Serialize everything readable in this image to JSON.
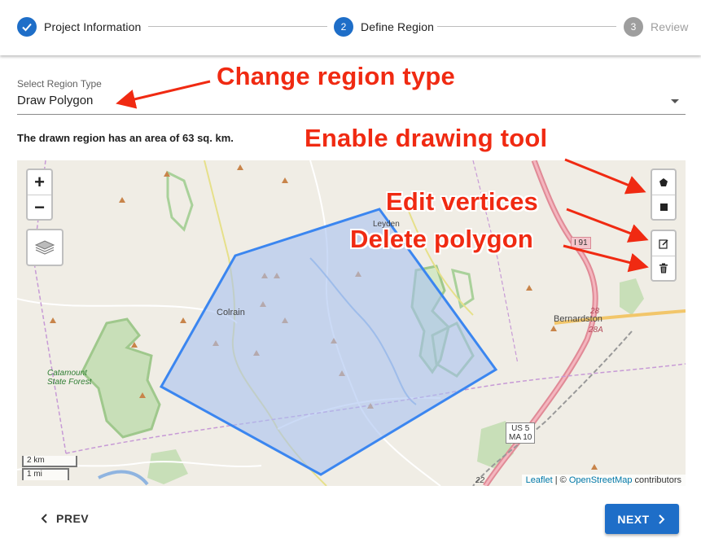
{
  "stepper": {
    "steps": [
      {
        "label": "Project Information",
        "number": "",
        "state": "done"
      },
      {
        "label": "Define Region",
        "number": "2",
        "state": "active"
      },
      {
        "label": "Review",
        "number": "3",
        "state": "todo"
      }
    ]
  },
  "region_select": {
    "label": "Select Region Type",
    "value": "Draw Polygon"
  },
  "area_text": "The drawn region has an area of 63 sq. km.",
  "map": {
    "zoom_in_label": "+",
    "zoom_out_label": "−",
    "scale_km": "2 km",
    "scale_mi": "1 mi",
    "attribution": {
      "leaflet": "Leaflet",
      "separator": " | © ",
      "osm": "OpenStreetMap",
      "suffix": " contributors"
    },
    "place_labels": {
      "colrain": "Colrain",
      "leyden": "Leyden",
      "bernardston": "Bernardston",
      "catamount": "Catamount",
      "state_forest": "State Forest"
    },
    "route_shields": {
      "i91": "I 91",
      "ma28": "28",
      "ma28a": "28A",
      "us5_line1": "US 5",
      "us5_line2": "MA 10",
      "road22": "22"
    },
    "polygon_color": "#3b86f0",
    "polygon_fill": "#a8c2f0"
  },
  "annotations": {
    "change_region": "Change region type",
    "enable_drawing": "Enable drawing tool",
    "edit_vertices": "Edit vertices",
    "delete_polygon": "Delete polygon",
    "color": "#f02a12"
  },
  "nav": {
    "prev_label": "PREV",
    "next_label": "NEXT"
  },
  "colors": {
    "primary": "#1e6ec8",
    "muted": "#9e9e9e"
  }
}
